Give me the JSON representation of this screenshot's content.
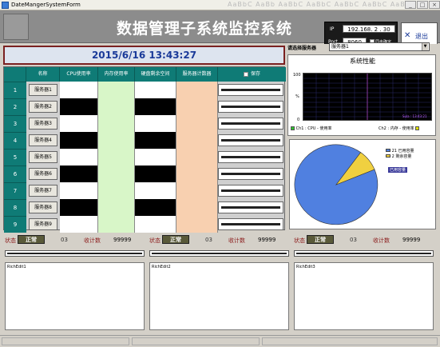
{
  "window": {
    "title": "DateMangerSystemForm",
    "ghost_text": "AaBbC AaBb AaBbC AaBbC AaBbC AaBbC AaBbC"
  },
  "header": {
    "title": "数据管理子系统监控系统",
    "ip_label": "IP",
    "ip_value": "192.168. 2 . 30",
    "port_label": "Port",
    "port_value": "8060",
    "sync_label": "同步确定",
    "exit_label": "退出"
  },
  "datetime": "2015/6/16 13:43:27",
  "grid": {
    "headers": [
      "",
      "名称",
      "CPU使用率",
      "内存使用率",
      "硬盘剩余空间",
      "服务器计数器",
      "保存"
    ],
    "rows": [
      {
        "index": "1",
        "name": "服务器1",
        "cpu": "#ffffff",
        "mem": "#d8f6c8",
        "disk": "#ffffff",
        "counter": "#f8d0b0"
      },
      {
        "index": "2",
        "name": "服务器2",
        "cpu": "#000000",
        "mem": "#d8f6c8",
        "disk": "#000000",
        "counter": "#f8d0b0"
      },
      {
        "index": "3",
        "name": "服务器3",
        "cpu": "#ffffff",
        "mem": "#d8f6c8",
        "disk": "#ffffff",
        "counter": "#f8d0b0"
      },
      {
        "index": "4",
        "name": "服务器4",
        "cpu": "#000000",
        "mem": "#d8f6c8",
        "disk": "#000000",
        "counter": "#f8d0b0"
      },
      {
        "index": "5",
        "name": "服务器5",
        "cpu": "#ffffff",
        "mem": "#d8f6c8",
        "disk": "#ffffff",
        "counter": "#f8d0b0"
      },
      {
        "index": "6",
        "name": "服务器6",
        "cpu": "#000000",
        "mem": "#d8f6c8",
        "disk": "#000000",
        "counter": "#f8d0b0"
      },
      {
        "index": "7",
        "name": "服务器7",
        "cpu": "#ffffff",
        "mem": "#d8f6c8",
        "disk": "#ffffff",
        "counter": "#f8d0b0"
      },
      {
        "index": "8",
        "name": "服务器8",
        "cpu": "#000000",
        "mem": "#d8f6c8",
        "disk": "#000000",
        "counter": "#f8d0b0"
      },
      {
        "index": "9",
        "name": "服务器9",
        "cpu": "#ffffff",
        "mem": "#d8f6c8",
        "disk": "#ffffff",
        "counter": "#f8d0b0"
      }
    ]
  },
  "right_panel": {
    "select_label": "请选择服务器",
    "select_value": "服务器1",
    "perf_title": "系统性能",
    "y_max": "100",
    "y_min": "0",
    "y_ticks": [
      "100",
      "%",
      "0"
    ],
    "ch1_label": "Ch1 : CPU - 使用率",
    "ch2_label": "Ch2 : 内存 - 使用率",
    "plot_timestamp": "Sula : 13:43:21",
    "pie_legend": [
      "21 已用容量",
      "2 剩余容量"
    ],
    "pie_tag": "已用容量",
    "colors": {
      "ch1": "#30c030",
      "ch2": "#e0e000",
      "pie_used": "#5080e0",
      "pie_free": "#f0d040"
    }
  },
  "chart_data": {
    "type": "pie",
    "categories": [
      "已用容量",
      "剩余容量"
    ],
    "values": [
      21,
      2
    ]
  },
  "bottom_panels": [
    {
      "status_label": "状态",
      "status": "正常",
      "num": "03",
      "count_label": "收计数",
      "count": "99999",
      "editor": "RichEdit1"
    },
    {
      "status_label": "状态",
      "status": "正常",
      "num": "03",
      "count_label": "收计数",
      "count": "99999",
      "editor": "RichEdit2"
    },
    {
      "status_label": "状态",
      "status": "正常",
      "num": "03",
      "count_label": "收计数",
      "count": "99999",
      "editor": "RichEdit3"
    }
  ]
}
